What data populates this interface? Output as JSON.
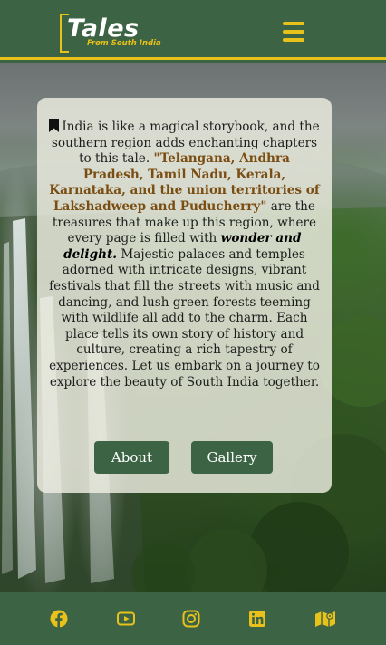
{
  "header": {
    "logo_title": "Tales",
    "logo_subtitle": "From South India",
    "menu_icon": "hamburger-menu-icon"
  },
  "intro": {
    "bookmark_icon": "bookmark-icon",
    "part1": "India is like a magical storybook, and the southern region adds enchanting chapters to this tale.",
    "highlight": "\"Telangana, Andhra Pradesh, Tamil Nadu, Kerala, Karnataka, and the union territories of Lakshadweep and Puducherry\"",
    "part2": "are the treasures that make up this region, where every page is filled with",
    "emphasis": "wonder and delight.",
    "part3": "Majestic palaces and temples adorned with intricate designs, vibrant festivals that fill the streets with music and dancing, and lush green forests teeming with wildlife all add to the charm. Each place tells its own story of history and culture, creating a rich tapestry of experiences. Let us embark on a journey to explore the beauty of South India together."
  },
  "buttons": {
    "about": "About",
    "gallery": "Gallery"
  },
  "footer": {
    "icons": [
      "facebook-icon",
      "youtube-icon",
      "instagram-icon",
      "linkedin-icon",
      "map-icon"
    ]
  },
  "colors": {
    "brand_green": "#3d6345",
    "accent_yellow": "#e8c21a",
    "highlight_brown": "#7a4d12",
    "card_bg": "#eeeee2"
  }
}
